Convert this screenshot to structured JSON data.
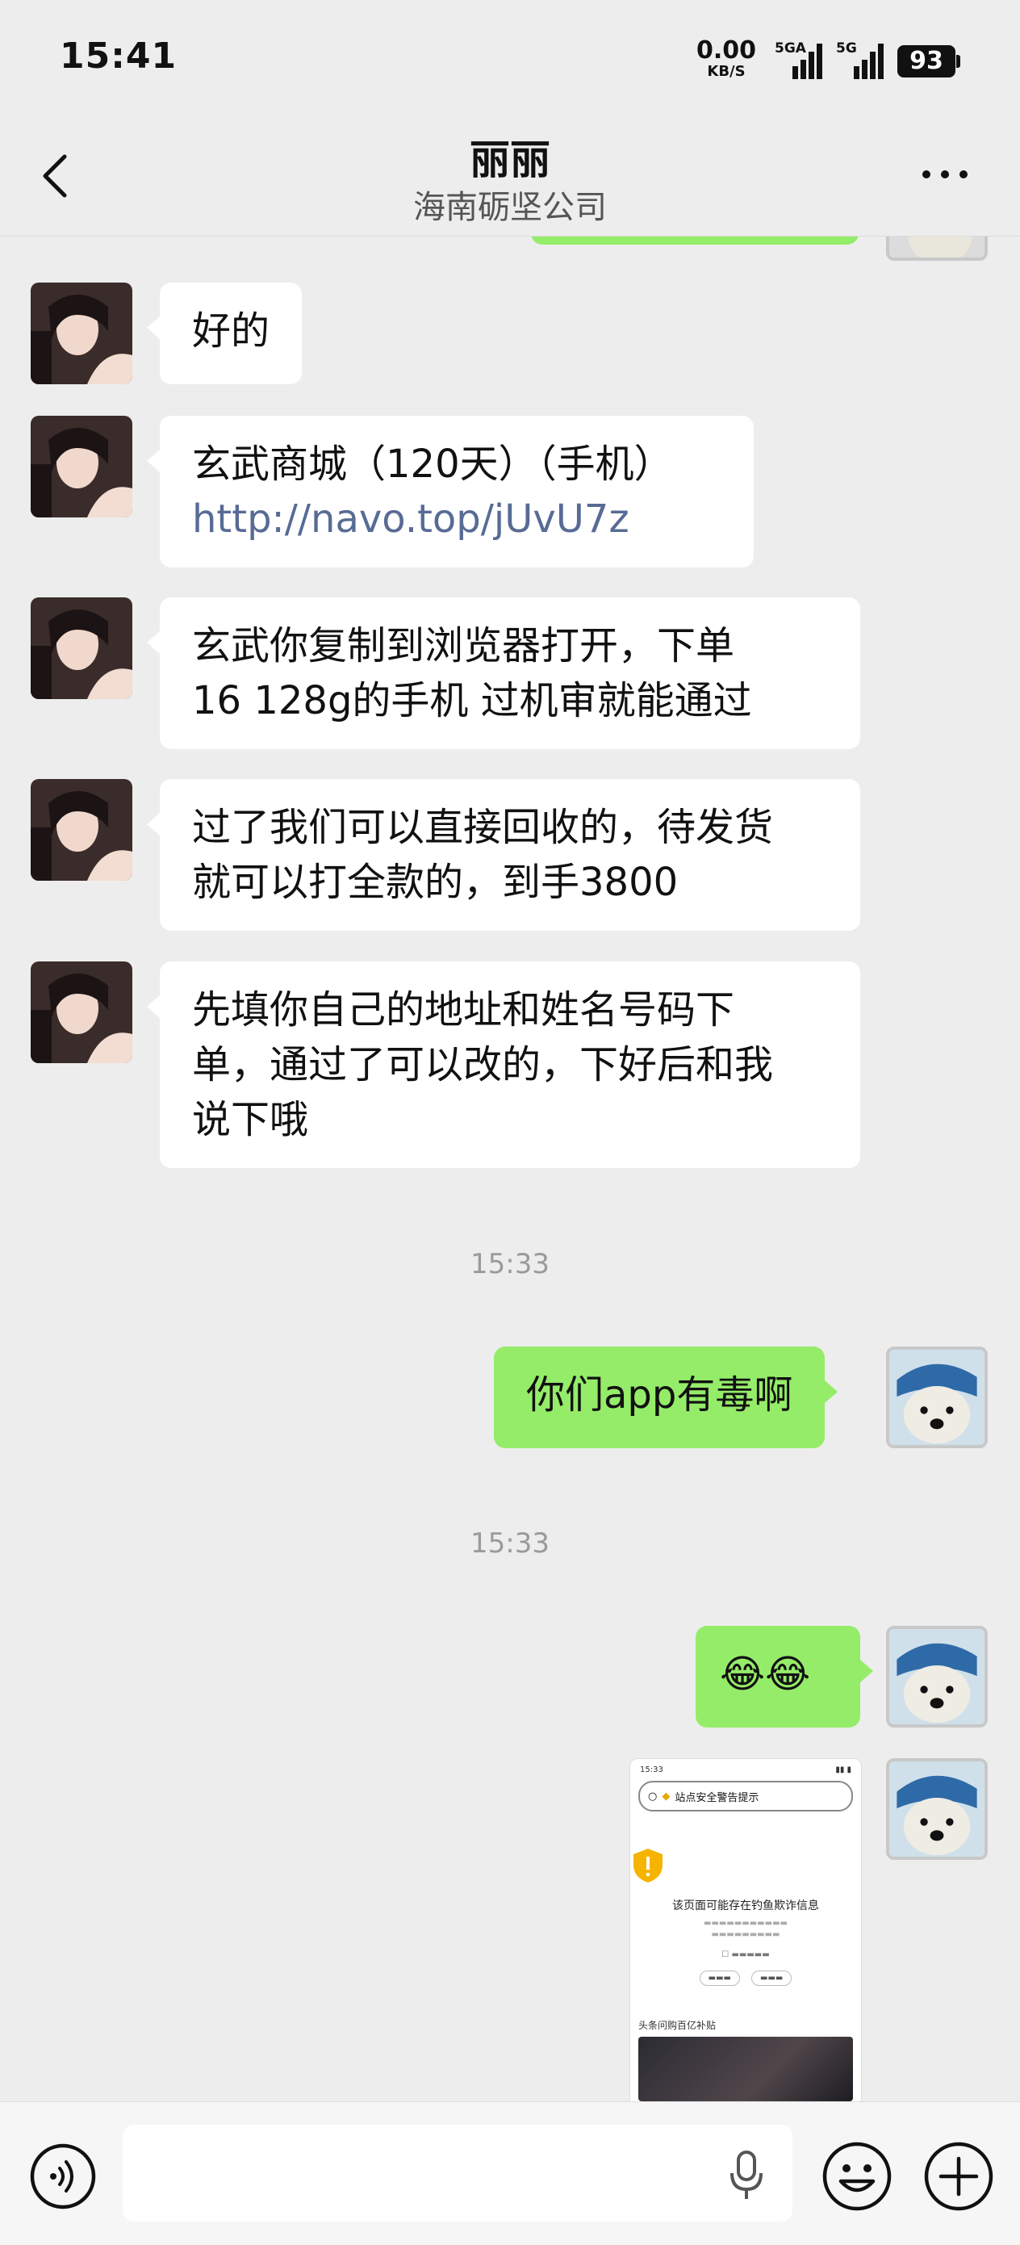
{
  "status_bar": {
    "time": "15:41",
    "net_speed": "0.00",
    "net_unit": "KB/S",
    "signal1": "5GA",
    "signal2": "5G",
    "battery": "93"
  },
  "header": {
    "title": "丽丽",
    "subtitle": "海南砺坚公司"
  },
  "messages": [
    {
      "side": "left",
      "text": "好的"
    },
    {
      "side": "left",
      "text": "玄武商城（120天）（手机）",
      "link": "http://navo.top/jUvU7z"
    },
    {
      "side": "left",
      "line1": "玄武你复制到浏览器打开，下单",
      "line2": "16 128g的手机  过机审就能通过"
    },
    {
      "side": "left",
      "line1": "过了我们可以直接回收的，待发货",
      "line2": "就可以打全款的，到手3800"
    },
    {
      "side": "left",
      "line1": "先填你自己的地址和姓名号码下",
      "line2": "单，通过了可以改的，下好后和我",
      "line3": "说下哦"
    },
    {
      "side": "right",
      "text": "你们app有毒啊"
    },
    {
      "side": "right",
      "text": "😂😂"
    }
  ],
  "timestamps": [
    "15:33",
    "15:33"
  ],
  "screenshot_thumb": {
    "time": "15:33",
    "banner": "站点安全警告提示",
    "heading": "该页面可能存在钓鱼欺诈信息",
    "footer_label": "头条问购百亿补贴"
  },
  "icons": {
    "back": "chevron-left-icon",
    "more": "more-dots-icon",
    "voice": "voice-mode-icon",
    "mic": "microphone-icon",
    "emoji": "emoji-icon",
    "plus": "plus-icon"
  },
  "colors": {
    "sent_bubble": "#95ec69",
    "received_bubble": "#ffffff",
    "link": "#576b95",
    "background": "#ededed"
  }
}
